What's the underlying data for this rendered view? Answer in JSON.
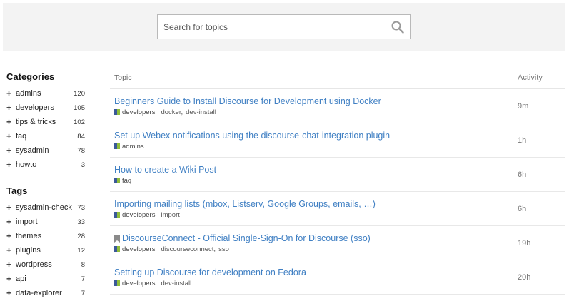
{
  "search": {
    "placeholder": "Search for topics"
  },
  "sidebar": {
    "categories_heading": "Categories",
    "categories": [
      {
        "name": "admins",
        "count": "120"
      },
      {
        "name": "developers",
        "count": "105"
      },
      {
        "name": "tips & tricks",
        "count": "102"
      },
      {
        "name": "faq",
        "count": "84"
      },
      {
        "name": "sysadmin",
        "count": "78"
      },
      {
        "name": "howto",
        "count": "3"
      }
    ],
    "tags_heading": "Tags",
    "tags": [
      {
        "name": "sysadmin-check",
        "count": "73"
      },
      {
        "name": "import",
        "count": "33"
      },
      {
        "name": "themes",
        "count": "28"
      },
      {
        "name": "plugins",
        "count": "12"
      },
      {
        "name": "wordpress",
        "count": "8"
      },
      {
        "name": "api",
        "count": "7"
      },
      {
        "name": "data-explorer",
        "count": "7"
      }
    ]
  },
  "topics": {
    "header_topic": "Topic",
    "header_activity": "Activity",
    "rows": [
      {
        "title": "Beginners Guide to Install Discourse for Development using Docker",
        "category": "developers",
        "tags": [
          "docker",
          "dev-install"
        ],
        "activity": "9m"
      },
      {
        "title": "Set up Webex notifications using the discourse-chat-integration plugin",
        "category": "admins",
        "tags": [],
        "activity": "1h"
      },
      {
        "title": "How to create a Wiki Post",
        "category": "faq",
        "tags": [],
        "activity": "6h"
      },
      {
        "title": "Importing mailing lists (mbox, Listserv, Google Groups, emails, …)",
        "category": "developers",
        "tags": [
          "import"
        ],
        "activity": "6h"
      },
      {
        "title": "DiscourseConnect - Official Single-Sign-On for Discourse (sso)",
        "category": "developers",
        "tags": [
          "discourseconnect",
          "sso"
        ],
        "activity": "19h",
        "bookmarked": true
      },
      {
        "title": "Setting up Discourse for development on Fedora",
        "category": "developers",
        "tags": [
          "dev-install"
        ],
        "activity": "20h"
      }
    ]
  }
}
